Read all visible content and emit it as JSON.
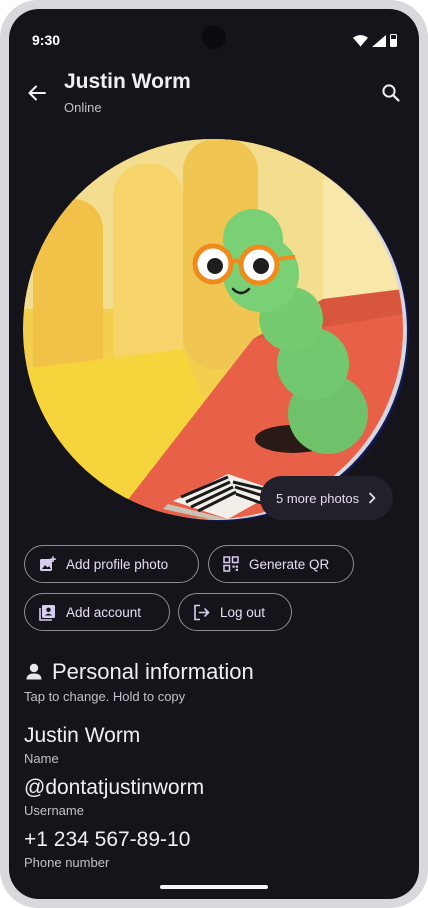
{
  "status_bar": {
    "time": "9:30"
  },
  "header": {
    "title": "Justin Worm",
    "subtitle": "Online"
  },
  "photo": {
    "more_photos_label": "5 more photos"
  },
  "actions": {
    "add_profile_photo": "Add profile photo",
    "generate_qr": "Generate QR",
    "add_account": "Add account",
    "log_out": "Log out"
  },
  "personal_info": {
    "title": "Personal information",
    "hint": "Tap to change. Hold to copy",
    "items": [
      {
        "value": "Justin Worm",
        "label": "Name"
      },
      {
        "value": "@dontatjustinworm",
        "label": "Username"
      },
      {
        "value": "+1 234 567-89-10",
        "label": "Phone number"
      }
    ]
  },
  "colors": {
    "background": "#16141b",
    "accent": "#e3dcef",
    "outline": "#8f8a98"
  }
}
